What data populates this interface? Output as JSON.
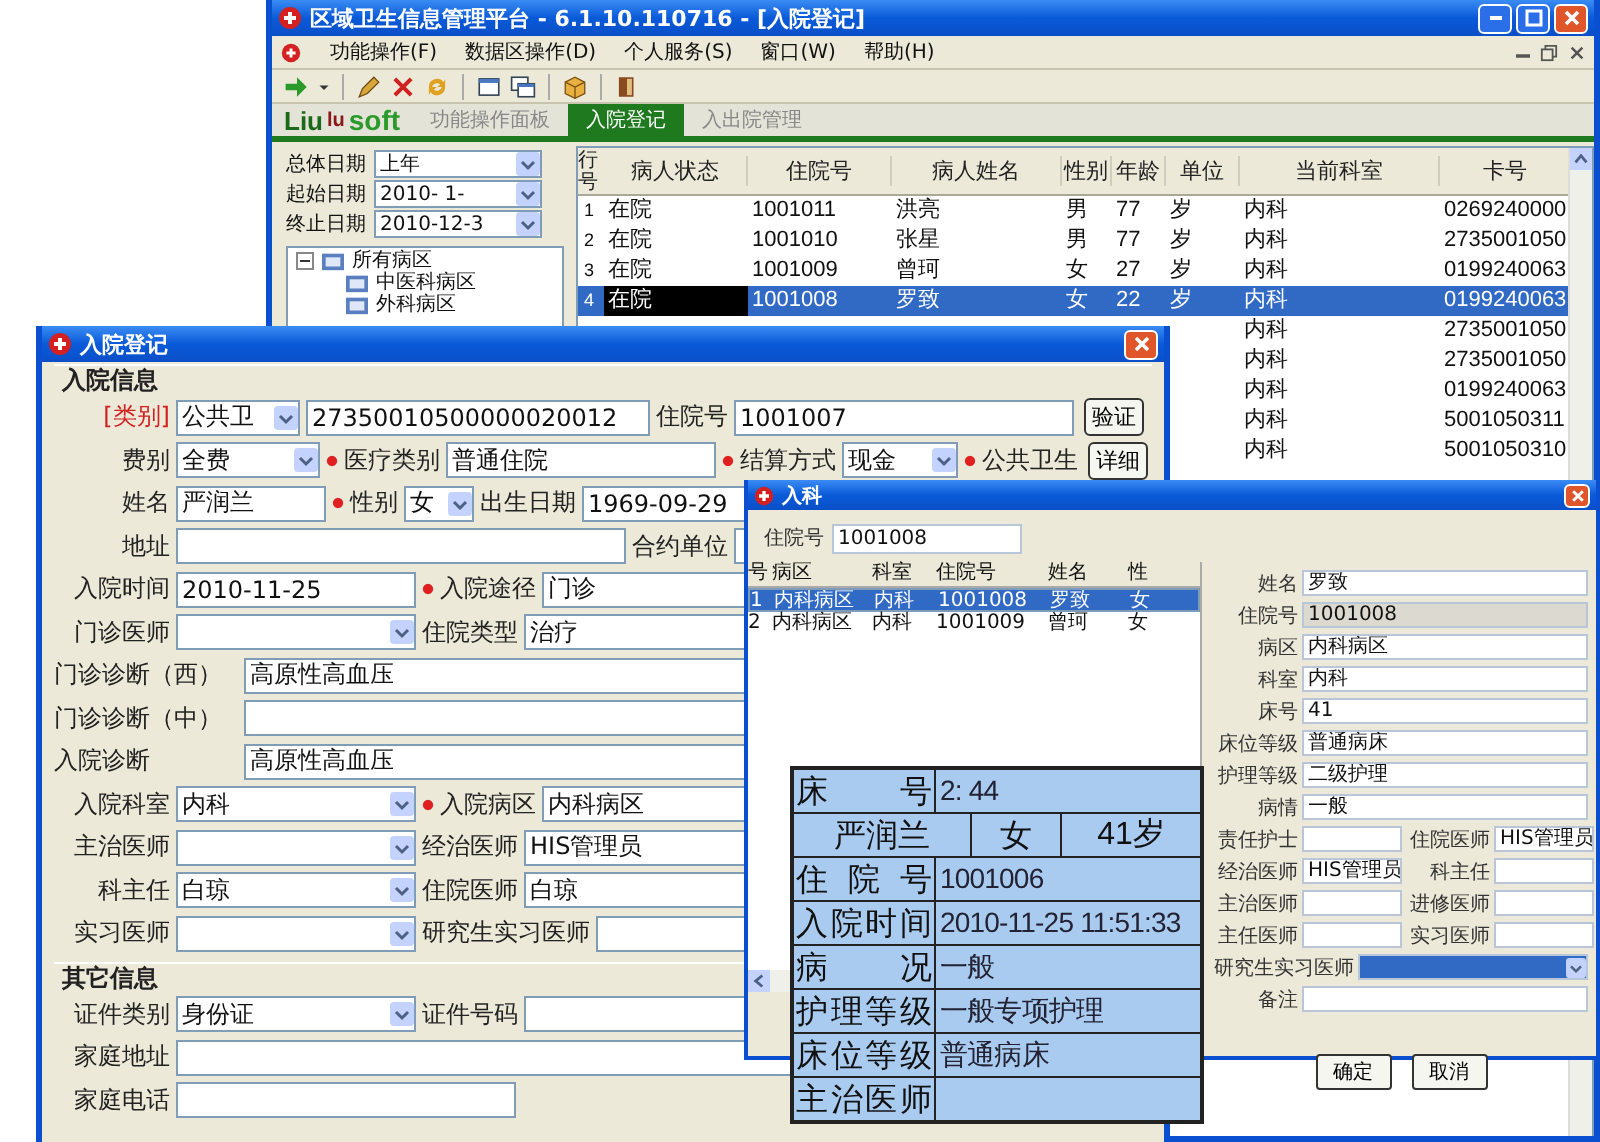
{
  "main_window": {
    "title": "区域卫生信息管理平台 - 6.1.10.110716 - [入院登记]",
    "menu": [
      "功能操作(F)",
      "数据区操作(D)",
      "个人服务(S)",
      "窗口(W)",
      "帮助(H)"
    ],
    "brand": [
      "Liu",
      "lu",
      "soft"
    ],
    "tabs": [
      {
        "label": "功能操作面板",
        "selected": false
      },
      {
        "label": "入院登记",
        "selected": true
      },
      {
        "label": "入出院管理",
        "selected": false
      }
    ],
    "filters": [
      {
        "label": "总体日期",
        "value": "上年"
      },
      {
        "label": "起始日期",
        "value": "2010- 1-"
      },
      {
        "label": "终止日期",
        "value": "2010-12-3"
      }
    ],
    "tree": [
      {
        "label": "所有病区",
        "expanded": true,
        "children": [
          {
            "label": "中医科病区"
          },
          {
            "label": "外科病区"
          }
        ]
      }
    ],
    "table": {
      "columns": [
        "行号",
        "病人状态",
        "住院号",
        "病人姓名",
        "性别",
        "年龄",
        "单位",
        "当前科室",
        "卡号"
      ],
      "rows": [
        {
          "selected": false,
          "focused": false,
          "number": "1",
          "status": "在院",
          "admission_no": "1001011",
          "name": "洪亮",
          "sex": "男",
          "age": "77",
          "unit": "岁",
          "department": "内科",
          "card_no": "0269240000"
        },
        {
          "selected": false,
          "focused": false,
          "number": "2",
          "status": "在院",
          "admission_no": "1001010",
          "name": "张星",
          "sex": "男",
          "age": "77",
          "unit": "岁",
          "department": "内科",
          "card_no": "2735001050"
        },
        {
          "selected": false,
          "focused": false,
          "number": "3",
          "status": "在院",
          "admission_no": "1001009",
          "name": "曾珂",
          "sex": "女",
          "age": "27",
          "unit": "岁",
          "department": "内科",
          "card_no": "0199240063"
        },
        {
          "selected": true,
          "focused": true,
          "number": "4",
          "status": "在院",
          "admission_no": "1001008",
          "name": "罗致",
          "sex": "女",
          "age": "22",
          "unit": "岁",
          "department": "内科",
          "card_no": "0199240063"
        },
        {
          "selected": false,
          "department": "内科",
          "card_no": "2735001050"
        },
        {
          "selected": false,
          "department": "内科",
          "card_no": "2735001050"
        },
        {
          "selected": false,
          "department": "内科",
          "card_no": "0199240063"
        },
        {
          "selected": false,
          "department": "内科",
          "card_no": "5001050311"
        },
        {
          "selected": false,
          "department": "内科",
          "card_no": "5001050310"
        }
      ]
    }
  },
  "register_dialog": {
    "title": "入院登记",
    "sections": [
      {
        "title": "入院信息",
        "rows": [
          [
            {
              "kind": "category",
              "label": "[类别]",
              "required": false,
              "value": "公共卫"
            },
            {
              "kind": "text",
              "value": "27350010500000020012"
            },
            {
              "kind": "text",
              "label": "住院号",
              "required": false,
              "value": "1001007"
            },
            {
              "kind": "button",
              "text": "验证"
            }
          ],
          [
            {
              "kind": "select",
              "label": "费别",
              "required": false,
              "value": "全费"
            },
            {
              "kind": "text",
              "label": "医疗类别",
              "required": true,
              "value": "普通住院"
            },
            {
              "kind": "select",
              "label": "结算方式",
              "required": true,
              "value": "现金"
            },
            {
              "kind": "button",
              "label": "公共卫生",
              "required": true,
              "text": "详细"
            }
          ],
          [
            {
              "kind": "text",
              "label": "姓名",
              "required": false,
              "value": "严润兰"
            },
            {
              "kind": "select",
              "label": "性别",
              "required": true,
              "value": "女"
            },
            {
              "kind": "text",
              "label": "出生日期",
              "required": false,
              "value": "1969-09-29"
            }
          ],
          [
            {
              "kind": "text",
              "label": "地址",
              "required": false
            },
            {
              "kind": "text",
              "label": "合约单位",
              "required": false
            }
          ],
          [
            {
              "kind": "text",
              "label": "入院时间",
              "required": false,
              "value": "2010-11-25"
            },
            {
              "kind": "text",
              "label": "入院途径",
              "required": true,
              "value": "门诊"
            }
          ],
          [
            {
              "kind": "select",
              "label": "门诊医师",
              "required": false
            },
            {
              "kind": "text",
              "label": "住院类型",
              "required": false,
              "value": "治疗"
            }
          ],
          [
            {
              "kind": "text",
              "label": "门诊诊断（西）",
              "required": false,
              "value": "高原性高血压"
            }
          ],
          [
            {
              "kind": "text",
              "label": "门诊诊断（中）",
              "required": false
            }
          ],
          [
            {
              "kind": "text",
              "label": "入院诊断",
              "required": false,
              "value": "高原性高血压"
            }
          ],
          [
            {
              "kind": "select",
              "label": "入院科室",
              "required": false,
              "value": "内科"
            },
            {
              "kind": "text",
              "label": "入院病区",
              "required": true,
              "value": "内科病区"
            }
          ],
          [
            {
              "kind": "select",
              "label": "主治医师",
              "required": false
            },
            {
              "kind": "text",
              "label": "经治医师",
              "required": false,
              "value": "HIS管理员"
            }
          ],
          [
            {
              "kind": "select",
              "label": "科主任",
              "required": false,
              "value": "白琼"
            },
            {
              "kind": "text",
              "label": "住院医师",
              "required": false,
              "value": "白琼"
            }
          ],
          [
            {
              "kind": "select",
              "label": "实习医师",
              "required": false
            },
            {
              "kind": "text",
              "label": "研究生实习医师",
              "required": false
            }
          ]
        ]
      },
      {
        "title": "其它信息",
        "rows": [
          [
            {
              "kind": "select",
              "label": "证件类别",
              "required": false,
              "value": "身份证"
            },
            {
              "kind": "text",
              "label": "证件号码",
              "required": false
            }
          ],
          [
            {
              "kind": "text",
              "label": "家庭地址",
              "required": false
            }
          ],
          [
            {
              "kind": "text",
              "label": "家庭电话",
              "required": false
            }
          ]
        ]
      }
    ]
  },
  "admit_dialog": {
    "title": "入科",
    "search": {
      "label": "住院号",
      "value": "1001008"
    },
    "list": {
      "columns": [
        "号",
        "病区",
        "科室",
        "住院号",
        "姓名",
        "性"
      ],
      "rows": [
        {
          "selected": true,
          "cells": [
            "1",
            "内科病区",
            "内科",
            "1001008",
            "罗致",
            "女"
          ]
        },
        {
          "selected": false,
          "cells": [
            "2",
            "内科病区",
            "内科",
            "1001009",
            "曾珂",
            "女"
          ]
        }
      ]
    },
    "form": [
      {
        "fields": [
          {
            "kind": "text",
            "label": "姓名",
            "value": "罗致",
            "disabled": false,
            "focused": false
          }
        ]
      },
      {
        "fields": [
          {
            "kind": "text",
            "label": "住院号",
            "value": "1001008",
            "disabled": true,
            "focused": false
          }
        ]
      },
      {
        "fields": [
          {
            "kind": "text",
            "label": "病区",
            "value": "内科病区",
            "disabled": false,
            "focused": false
          }
        ]
      },
      {
        "fields": [
          {
            "kind": "text",
            "label": "科室",
            "value": "内科",
            "disabled": false,
            "focused": false
          }
        ]
      },
      {
        "fields": [
          {
            "kind": "text",
            "label": "床号",
            "value": "41",
            "disabled": false,
            "focused": false
          }
        ]
      },
      {
        "fields": [
          {
            "kind": "text",
            "label": "床位等级",
            "value": "普通病床",
            "disabled": false,
            "focused": false
          }
        ]
      },
      {
        "fields": [
          {
            "kind": "text",
            "label": "护理等级",
            "value": "二级护理",
            "disabled": false,
            "focused": false
          }
        ]
      },
      {
        "fields": [
          {
            "kind": "text",
            "label": "病情",
            "value": "一般",
            "disabled": false,
            "focused": false
          }
        ]
      },
      {
        "fields": [
          {
            "kind": "text",
            "label": "责任护士",
            "disabled": false,
            "focused": false
          },
          {
            "kind": "text",
            "label": "住院医师",
            "value": "HIS管理员",
            "disabled": false,
            "focused": false
          }
        ]
      },
      {
        "fields": [
          {
            "kind": "text",
            "label": "经治医师",
            "value": "HIS管理员",
            "disabled": false,
            "focused": false
          },
          {
            "kind": "text",
            "label": "科主任",
            "disabled": false,
            "focused": false
          }
        ]
      },
      {
        "fields": [
          {
            "kind": "text",
            "label": "主治医师",
            "disabled": false,
            "focused": false
          },
          {
            "kind": "text",
            "label": "进修医师",
            "disabled": false,
            "focused": false
          }
        ]
      },
      {
        "fields": [
          {
            "kind": "text",
            "label": "主任医师",
            "disabled": false,
            "focused": false
          },
          {
            "kind": "text",
            "label": "实习医师",
            "disabled": false,
            "focused": false
          }
        ]
      },
      {
        "fields": [
          {
            "kind": "select",
            "label": "研究生实习医师",
            "disabled": false,
            "focused": true
          }
        ]
      },
      {
        "fields": [
          {
            "kind": "text",
            "label": "备注",
            "disabled": false,
            "focused": false
          }
        ]
      }
    ],
    "buttons": [
      "确定",
      "取消"
    ]
  },
  "bed_card": {
    "rows": [
      {
        "kind": "field",
        "label": "床号",
        "value": "2: 44"
      },
      {
        "kind": "triple",
        "cells": [
          "严润兰",
          "女",
          "41岁"
        ]
      },
      {
        "kind": "field",
        "label": "住院号",
        "value": "1001006"
      },
      {
        "kind": "field",
        "label": "入院时间",
        "value": "2010-11-25 11:51:33"
      },
      {
        "kind": "field",
        "label": "病况",
        "value": "一般"
      },
      {
        "kind": "field",
        "label": "护理等级",
        "value": "一般专项护理"
      },
      {
        "kind": "field",
        "label": "床位等级",
        "value": "普通病床"
      },
      {
        "kind": "field",
        "label": "主治医师"
      }
    ]
  }
}
